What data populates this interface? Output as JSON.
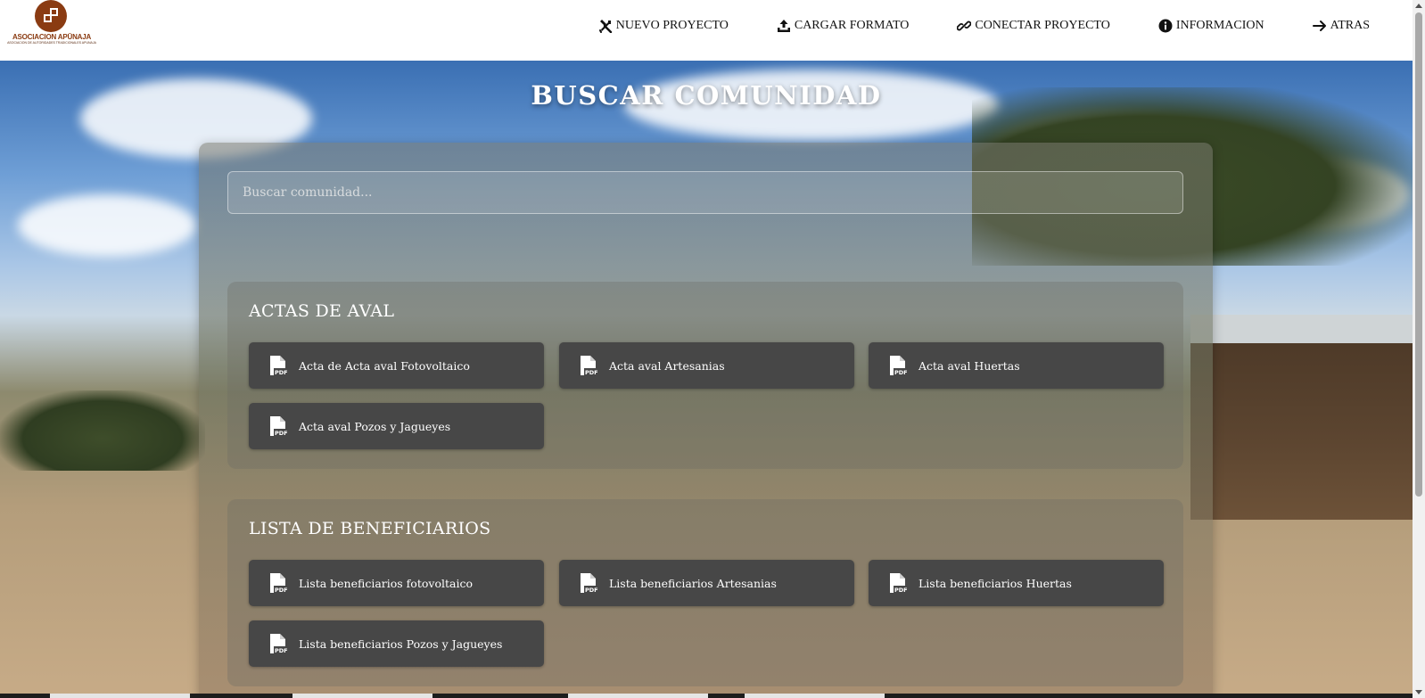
{
  "header": {
    "logo": {
      "name": "ASOCIACION APŪNAJA",
      "tagline": "ASOCIACION DE AUTORIDADES TRADICIONALES APUNAJA"
    },
    "nav": [
      {
        "label": "NUEVO PROYECTO",
        "icon": "tools-icon"
      },
      {
        "label": "CARGAR FORMATO",
        "icon": "upload-icon"
      },
      {
        "label": "CONECTAR PROYECTO",
        "icon": "link-icon"
      },
      {
        "label": "INFORMACION",
        "icon": "info-icon"
      },
      {
        "label": "ATRAS",
        "icon": "arrow-right-icon"
      }
    ]
  },
  "main": {
    "title": "BUSCAR COMUNIDAD",
    "search": {
      "placeholder": "Buscar comunidad...",
      "value": ""
    },
    "sections": [
      {
        "title": "ACTAS DE AVAL",
        "documents": [
          "Acta de Acta aval Fotovoltaico",
          "Acta aval Artesanias",
          "Acta aval Huertas",
          "Acta aval Pozos y Jagueyes"
        ]
      },
      {
        "title": "LISTA DE BENEFICIARIOS",
        "documents": [
          "Lista beneficiarios fotovoltaico",
          "Lista beneficiarios Artesanias",
          "Lista beneficiarios Huertas",
          "Lista beneficiarios Pozos y Jagueyes"
        ]
      }
    ]
  },
  "colors": {
    "brand": "#8a3b12",
    "button_bg": "#474747",
    "header_bg": "#ffffff",
    "text_light": "#ffffff"
  }
}
